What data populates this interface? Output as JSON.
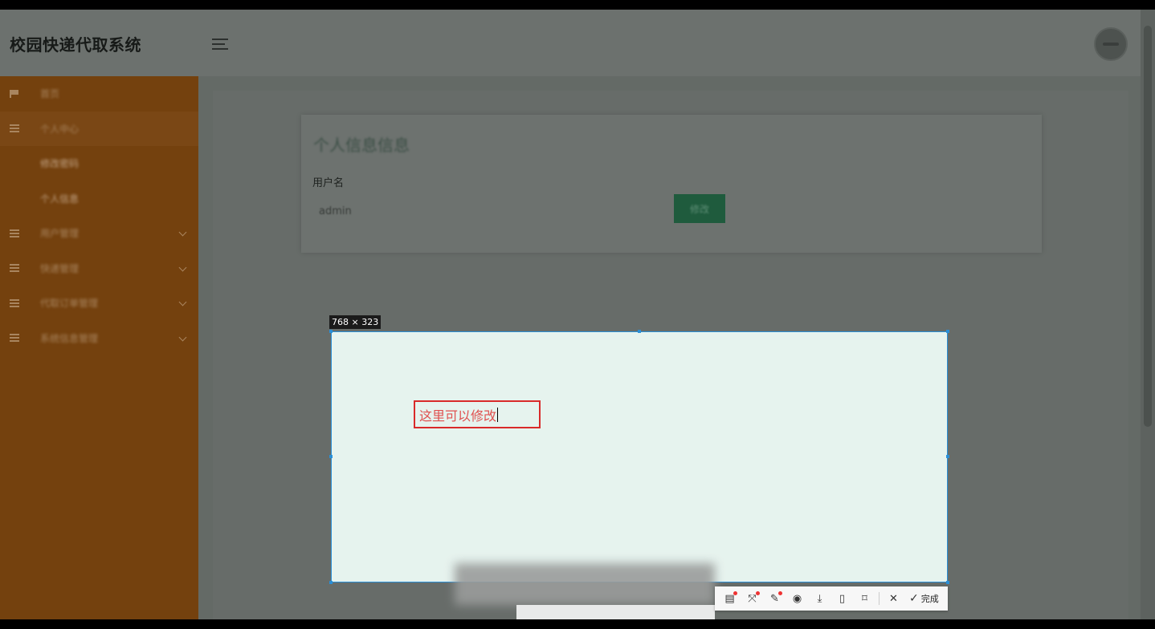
{
  "app": {
    "title": "校园快递代取系统"
  },
  "sidebar": {
    "items": [
      {
        "label": "首页",
        "icon": "flag-icon",
        "type": "top",
        "chevron": false
      },
      {
        "label": "个人中心",
        "icon": "list-icon",
        "type": "top",
        "active": true,
        "chevron": false
      },
      {
        "label": "修改密码",
        "type": "sub"
      },
      {
        "label": "个人信息",
        "type": "sub"
      },
      {
        "label": "用户管理",
        "icon": "list-icon",
        "type": "top",
        "chevron": true
      },
      {
        "label": "快递管理",
        "icon": "list-icon",
        "type": "top",
        "chevron": true
      },
      {
        "label": "代取订单管理",
        "icon": "list-icon",
        "type": "top",
        "chevron": true
      },
      {
        "label": "系统信息管理",
        "icon": "list-icon",
        "type": "top",
        "chevron": true
      }
    ]
  },
  "card": {
    "title": "个人信息信息",
    "username_label": "用户名",
    "username_value": "admin",
    "modify_label": "修改"
  },
  "capture": {
    "size_label": "768 × 323",
    "annotation_text": "这里可以修改"
  },
  "toolbar": {
    "tools": [
      "ocr-icon",
      "screenshot-translate-icon",
      "pin-icon",
      "record-icon",
      "download-icon",
      "save-icon",
      "bookmark-icon"
    ],
    "close_glyph": "✕",
    "done_label": "完成"
  }
}
